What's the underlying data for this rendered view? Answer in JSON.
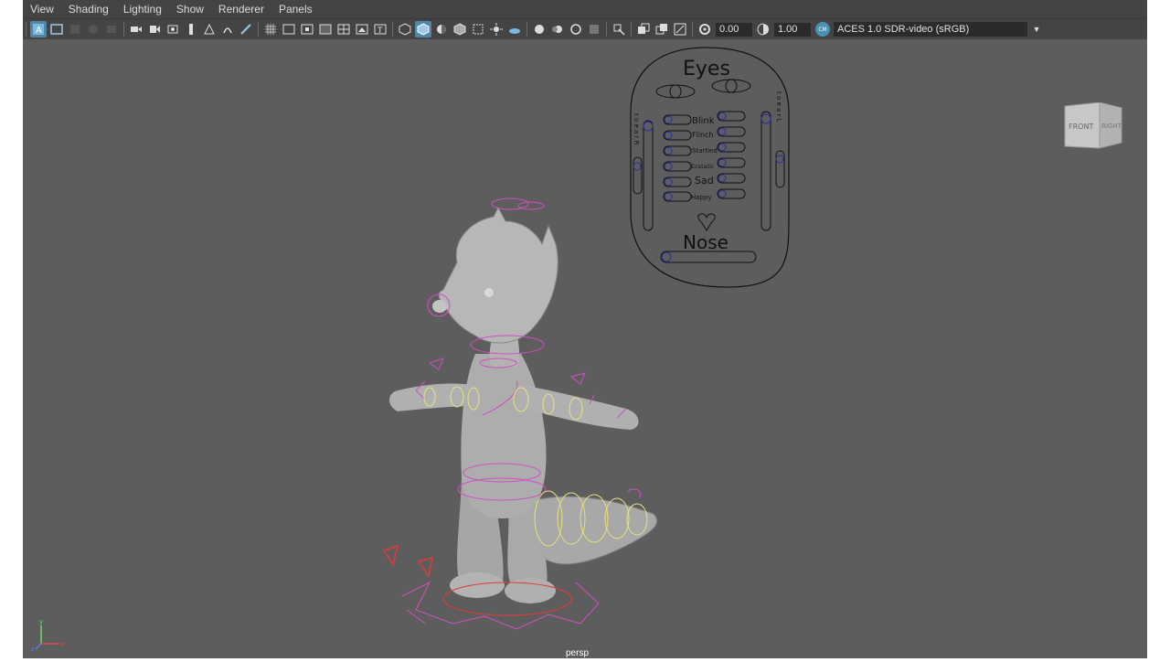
{
  "menu": [
    "View",
    "Shading",
    "Lighting",
    "Show",
    "Renderer",
    "Panels"
  ],
  "toolbar": {
    "exposure_value": "0.00",
    "gamma_value": "1.00",
    "color_management_label": "ACES 1.0 SDR-video (sRGB)"
  },
  "picker": {
    "eyes_title": "Eyes",
    "nose_title": "Nose",
    "expressions": [
      "Blink",
      "Flinch",
      "Startled",
      "Ecstatic",
      "Sad",
      "Happy"
    ],
    "left_side_vertical": "t o e a r R",
    "right_side_vertical": "t o e a r L"
  },
  "viewcube": {
    "front": "FRONT",
    "right": "RIGHT"
  },
  "axis": {
    "x": "x",
    "y": "y",
    "z": "z"
  },
  "camera_label": "persp"
}
